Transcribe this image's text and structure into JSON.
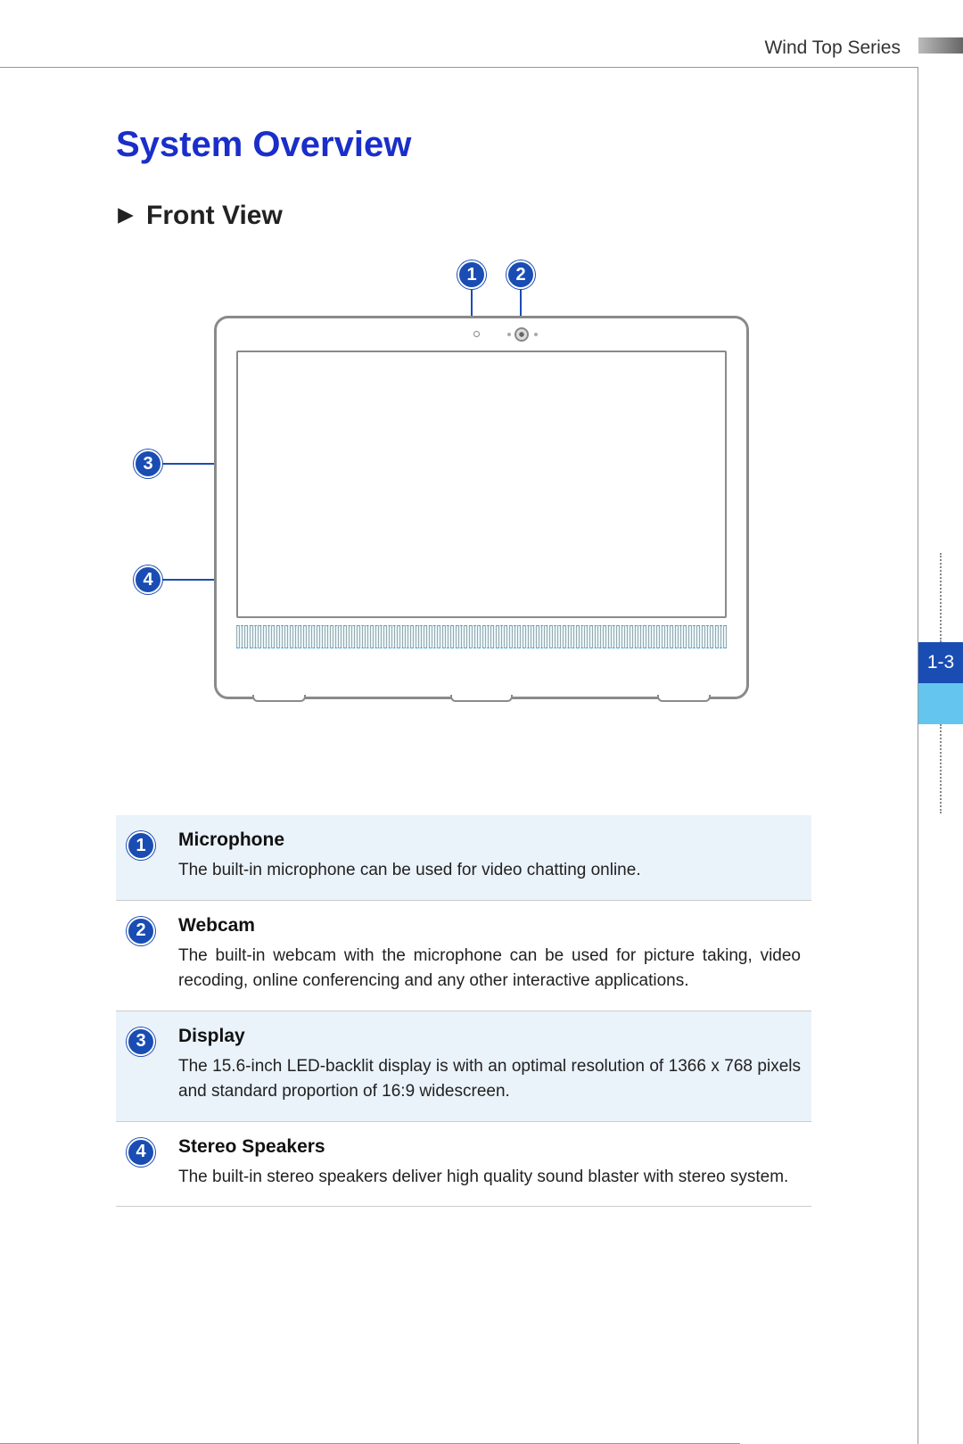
{
  "header": {
    "series_label": "Wind Top Series"
  },
  "title": "System Overview",
  "section": "Front View",
  "callouts": {
    "c1": "1",
    "c2": "2",
    "c3": "3",
    "c4": "4"
  },
  "legend": [
    {
      "num": "1",
      "title": "Microphone",
      "desc": "The built-in microphone can be used for video chatting online."
    },
    {
      "num": "2",
      "title": "Webcam",
      "desc": "The built-in webcam with the microphone can be used for picture taking, video recoding, online conferencing and any other interactive applications."
    },
    {
      "num": "3",
      "title": "Display",
      "desc": "The 15.6-inch LED-backlit display is with an optimal resolution of 1366 x 768 pixels and standard proportion of 16:9 widescreen."
    },
    {
      "num": "4",
      "title": "Stereo Speakers",
      "desc": "The built-in stereo speakers deliver high quality sound blaster with stereo system."
    }
  ],
  "page_number": "1-3"
}
